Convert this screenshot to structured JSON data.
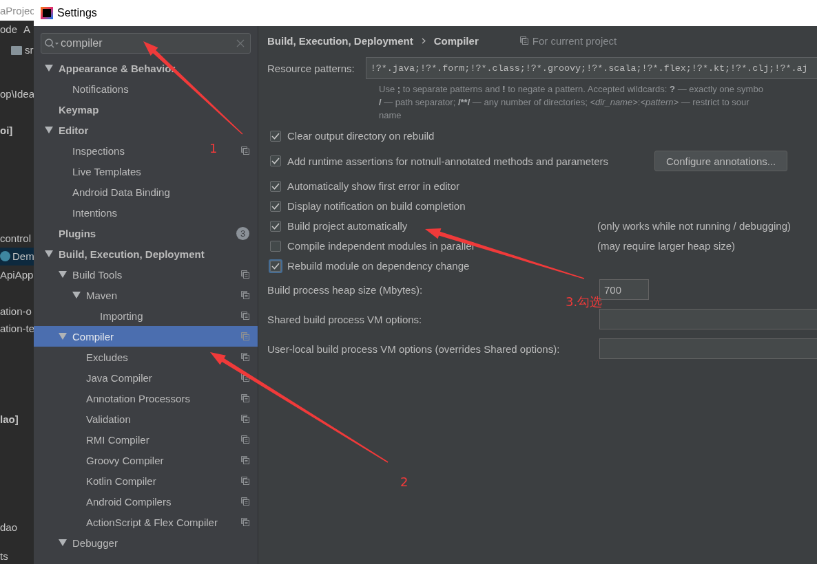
{
  "background_window": {
    "title": "aProjec",
    "texts": [
      {
        "text": "ode",
        "bold": false,
        "selected": false
      },
      {
        "text": "A",
        "bold": false,
        "selected": false
      },
      {
        "text": "sr",
        "bold": false,
        "selected": false
      },
      {
        "text": "op\\Idea",
        "bold": false,
        "selected": false
      },
      {
        "text": "oi]",
        "bold": true,
        "selected": false
      },
      {
        "text": "control",
        "bold": false,
        "selected": false
      },
      {
        "text": "Dem",
        "bold": false,
        "selected": true
      },
      {
        "text": "ApiApp",
        "bold": false,
        "selected": false
      },
      {
        "text": "ation-o",
        "bold": false,
        "selected": false
      },
      {
        "text": "ation-te",
        "bold": false,
        "selected": false
      },
      {
        "text": "lao]",
        "bold": true,
        "selected": false
      },
      {
        "text": "dao",
        "bold": false,
        "selected": false
      },
      {
        "text": "ts",
        "bold": false,
        "selected": false
      }
    ]
  },
  "window": {
    "title": "Settings"
  },
  "search": {
    "value": "compiler"
  },
  "tree": [
    {
      "label": "Appearance & Behavior",
      "expanded": true,
      "selected": false,
      "project": false,
      "children": [
        {
          "label": "Notifications",
          "selected": false,
          "project": false
        }
      ]
    },
    {
      "label": "Keymap",
      "selected": false,
      "project": false
    },
    {
      "label": "Editor",
      "expanded": true,
      "selected": false,
      "project": false,
      "children": [
        {
          "label": "Inspections",
          "selected": false,
          "project": true
        },
        {
          "label": "Live Templates",
          "selected": false,
          "project": false
        },
        {
          "label": "Android Data Binding",
          "selected": false,
          "project": false
        },
        {
          "label": "Intentions",
          "selected": false,
          "project": false
        }
      ]
    },
    {
      "label": "Plugins",
      "selected": false,
      "project": false,
      "badge": "3"
    },
    {
      "label": "Build, Execution, Deployment",
      "expanded": true,
      "selected": false,
      "project": false,
      "children": [
        {
          "label": "Build Tools",
          "expanded": true,
          "selected": false,
          "project": true,
          "children": [
            {
              "label": "Maven",
              "expanded": true,
              "selected": false,
              "project": true,
              "children": [
                {
                  "label": "Importing",
                  "selected": false,
                  "project": true
                }
              ]
            }
          ]
        },
        {
          "label": "Compiler",
          "expanded": true,
          "selected": true,
          "project": true,
          "children": [
            {
              "label": "Excludes",
              "selected": false,
              "project": true
            },
            {
              "label": "Java Compiler",
              "selected": false,
              "project": true
            },
            {
              "label": "Annotation Processors",
              "selected": false,
              "project": true
            },
            {
              "label": "Validation",
              "selected": false,
              "project": true
            },
            {
              "label": "RMI Compiler",
              "selected": false,
              "project": true
            },
            {
              "label": "Groovy Compiler",
              "selected": false,
              "project": true
            },
            {
              "label": "Kotlin Compiler",
              "selected": false,
              "project": true
            },
            {
              "label": "Android Compilers",
              "selected": false,
              "project": true
            },
            {
              "label": "ActionScript & Flex Compiler",
              "selected": false,
              "project": true
            }
          ]
        },
        {
          "label": "Debugger",
          "expanded": true,
          "selected": false,
          "project": false
        }
      ]
    }
  ],
  "breadcrumb": [
    "Build, Execution, Deployment",
    "Compiler"
  ],
  "scope": "For current project",
  "resource_patterns": {
    "label": "Resource patterns:",
    "value": "!?*.java;!?*.form;!?*.class;!?*.groovy;!?*.scala;!?*.flex;!?*.kt;!?*.clj;!?*.aj"
  },
  "hint_lines": [
    [
      {
        "text": "Use "
      },
      {
        "text": ";",
        "bold": true
      },
      {
        "text": " to separate patterns and "
      },
      {
        "text": "!",
        "bold": true
      },
      {
        "text": " to negate a pattern. Accepted wildcards: "
      },
      {
        "text": "?",
        "bold": true
      },
      {
        "text": " — exactly one symbo"
      }
    ],
    [
      {
        "text": "/",
        "bold": true
      },
      {
        "text": " — path separator; "
      },
      {
        "text": "/**/",
        "bold": true
      },
      {
        "text": " — any number of directories; "
      },
      {
        "text": "<dir_name>",
        "italic": true
      },
      {
        "text": ":"
      },
      {
        "text": "<pattern>",
        "italic": true
      },
      {
        "text": " — restrict to sour"
      }
    ],
    [
      {
        "text": "name"
      }
    ]
  ],
  "options": [
    {
      "label": "Clear output directory on rebuild",
      "checked": true,
      "focused": false
    },
    {
      "label": "Add runtime assertions for notnull-annotated methods and parameters",
      "checked": true,
      "focused": false,
      "button": "Configure annotations..."
    },
    {
      "label": "Automatically show first error in editor",
      "checked": true,
      "focused": false
    },
    {
      "label": "Display notification on build completion",
      "checked": true,
      "focused": false
    },
    {
      "label": "Build project automatically",
      "checked": true,
      "focused": false,
      "note": "(only works while not running / debugging)"
    },
    {
      "label": "Compile independent modules in parallel",
      "checked": false,
      "focused": false,
      "note": "(may require larger heap size)"
    },
    {
      "label": "Rebuild module on dependency change",
      "checked": true,
      "focused": true
    }
  ],
  "fields": [
    {
      "label": "Build process heap size (Mbytes):",
      "value": "700",
      "kind": "short"
    },
    {
      "label": "Shared build process VM options:",
      "kind": "wide"
    },
    {
      "label": "User-local build process VM options (overrides Shared options):",
      "kind": "wide"
    }
  ],
  "annotations": [
    {
      "label": "1"
    },
    {
      "label": "2"
    },
    {
      "label": "3.勾选"
    }
  ]
}
